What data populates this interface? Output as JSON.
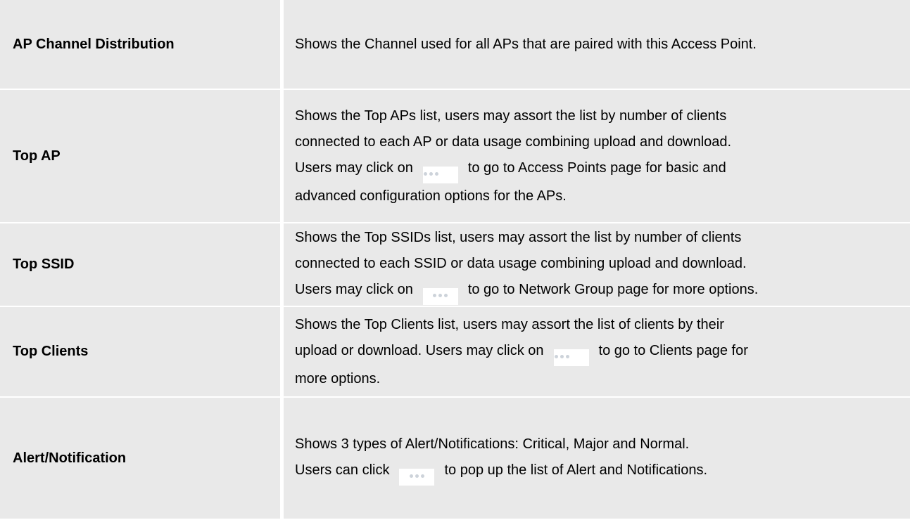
{
  "rows": [
    {
      "label": "AP Channel Distribution",
      "lines": [
        "Shows the Channel used for all APs that are paired with this Access Point."
      ]
    },
    {
      "label": "Top AP",
      "lines": [
        "Shows the Top APs list, users may assort the list by number of clients",
        "connected to each AP or data usage combining upload and download.",
        "Users may click on",
        "to go to Access Points page for basic and",
        "advanced configuration options for the APs."
      ]
    },
    {
      "label": "Top SSID",
      "lines": [
        "Shows the Top SSIDs list, users may assort the list by number of clients",
        "connected to each SSID or data usage combining upload and download.",
        "Users may click on",
        "to go to Network Group page for more options."
      ]
    },
    {
      "label": "Top Clients",
      "lines": [
        "Shows the Top Clients list, users may assort the list of clients by their",
        "upload or download. Users may click on",
        "to go to Clients page for",
        "more options."
      ]
    },
    {
      "label": "Alert/Notification",
      "lines": [
        "Shows 3 types of Alert/Notifications: Critical, Major and Normal.",
        "Users can click",
        "to pop up the list of Alert and Notifications."
      ]
    }
  ],
  "icon": "more-dots-icon"
}
